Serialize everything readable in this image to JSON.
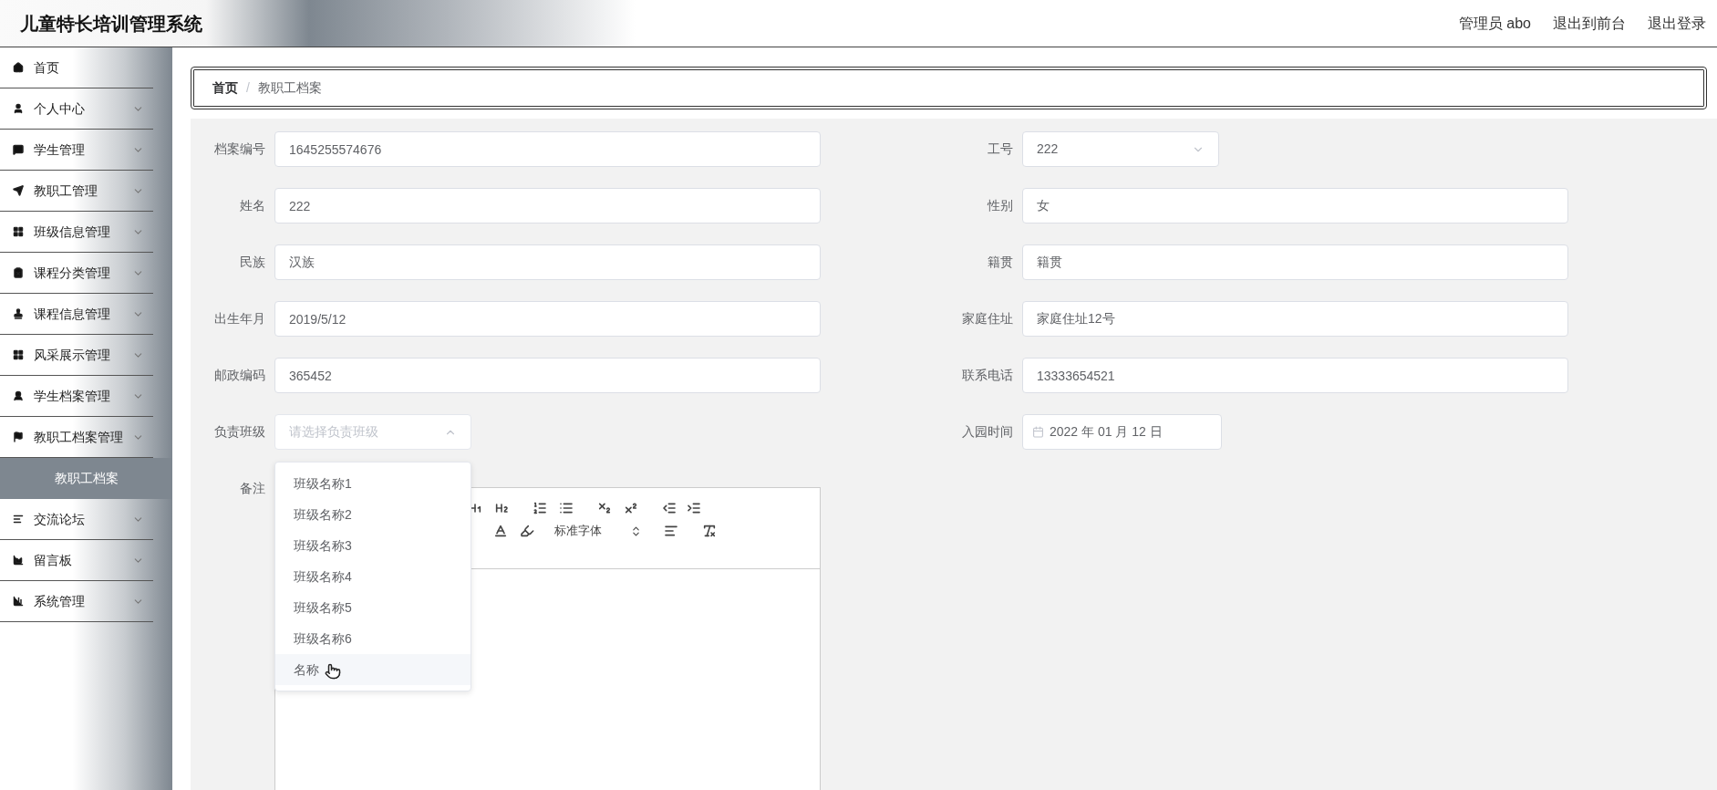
{
  "header": {
    "title": "儿童特长培训管理系统",
    "user": "管理员 abo",
    "links": [
      "退出到前台",
      "退出登录"
    ]
  },
  "sidebar": {
    "items": [
      {
        "label": "首页",
        "kind": "link"
      },
      {
        "label": "个人中心",
        "kind": "menu"
      },
      {
        "label": "学生管理",
        "kind": "menu"
      },
      {
        "label": "教职工管理",
        "kind": "menu"
      },
      {
        "label": "班级信息管理",
        "kind": "menu"
      },
      {
        "label": "课程分类管理",
        "kind": "menu"
      },
      {
        "label": "课程信息管理",
        "kind": "menu"
      },
      {
        "label": "风采展示管理",
        "kind": "menu"
      },
      {
        "label": "学生档案管理",
        "kind": "menu"
      },
      {
        "label": "教职工档案管理",
        "kind": "menu",
        "children": [
          {
            "label": "教职工档案",
            "selected": true
          }
        ]
      },
      {
        "label": "交流论坛",
        "kind": "menu"
      },
      {
        "label": "留言板",
        "kind": "menu"
      },
      {
        "label": "系统管理",
        "kind": "menu"
      }
    ]
  },
  "breadcrumb": {
    "separator": "/",
    "items": [
      "首页",
      "教职工档案"
    ]
  },
  "form": {
    "rows": [
      [
        {
          "label": "档案编号",
          "kind": "text",
          "value": "1645255574676"
        },
        {
          "label": "工号",
          "kind": "select",
          "value": "222",
          "open": false
        }
      ],
      [
        {
          "label": "姓名",
          "kind": "text",
          "value": "222"
        },
        {
          "label": "性别",
          "kind": "text",
          "value": "女"
        }
      ],
      [
        {
          "label": "民族",
          "kind": "text",
          "value": "汉族"
        },
        {
          "label": "籍贯",
          "kind": "text",
          "value": "籍贯"
        }
      ],
      [
        {
          "label": "出生年月",
          "kind": "text",
          "value": "2019/5/12"
        },
        {
          "label": "家庭住址",
          "kind": "text",
          "value": "家庭住址12号"
        }
      ],
      [
        {
          "label": "邮政编码",
          "kind": "text",
          "value": "365452"
        },
        {
          "label": "联系电话",
          "kind": "text",
          "value": "13333654521"
        }
      ],
      [
        {
          "label": "负责班级",
          "kind": "select",
          "placeholder": "请选择负责班级",
          "open": true
        },
        {
          "label": "入园时间",
          "kind": "date",
          "value": "2022 年 01 月 12 日"
        }
      ],
      [
        {
          "label": "备注",
          "kind": "editor",
          "font_select": "标准字体"
        }
      ]
    ]
  },
  "dropdown": {
    "options": [
      {
        "label": "班级名称1",
        "hovered": false
      },
      {
        "label": "班级名称2",
        "hovered": false
      },
      {
        "label": "班级名称3",
        "hovered": false
      },
      {
        "label": "班级名称4",
        "hovered": false
      },
      {
        "label": "班级名称5",
        "hovered": false
      },
      {
        "label": "班级名称6",
        "hovered": false
      },
      {
        "label": "名称",
        "hovered": true
      }
    ]
  }
}
